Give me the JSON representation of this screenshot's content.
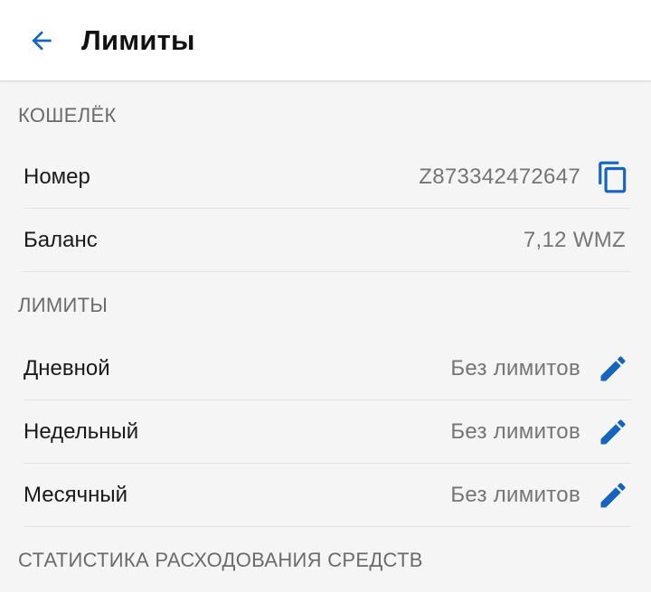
{
  "header": {
    "back_icon": "arrow-left-icon",
    "title": "Лимиты"
  },
  "wallet": {
    "section_title": "КОШЕЛЁК",
    "number_label": "Номер",
    "number_value": "Z873342472647",
    "copy_icon": "copy-icon",
    "balance_label": "Баланс",
    "balance_value": "7,12 WMZ"
  },
  "limits": {
    "section_title": "ЛИМИТЫ",
    "items": [
      {
        "label": "Дневной",
        "value": "Без лимитов",
        "icon": "edit-pencil-icon"
      },
      {
        "label": "Недельный",
        "value": "Без лимитов",
        "icon": "edit-pencil-icon"
      },
      {
        "label": "Месячный",
        "value": "Без лимитов",
        "icon": "edit-pencil-icon"
      }
    ]
  },
  "stats": {
    "section_title": "СТАТИСТИКА РАСХОДОВАНИЯ СРЕДСТВ"
  },
  "colors": {
    "accent": "#1565c0",
    "background": "#f5f5f5",
    "secondary_text": "#757575"
  }
}
